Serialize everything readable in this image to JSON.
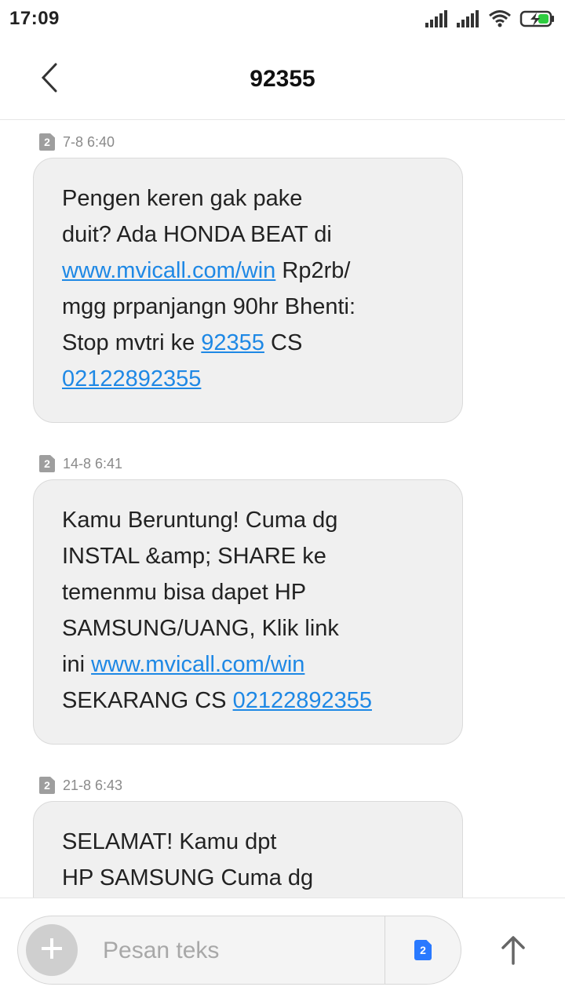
{
  "status_bar": {
    "time": "17:09",
    "icons": [
      "signal-icon",
      "signal-icon",
      "wifi-icon",
      "battery-charging-icon"
    ]
  },
  "header": {
    "title": "92355",
    "back_icon": "chevron-left-icon"
  },
  "messages": [
    {
      "sim": "2",
      "time": "7-8 6:40",
      "lines": [
        [
          {
            "t": "Pengen keren gak pake"
          }
        ],
        [
          {
            "t": "duit? Ada HONDA BEAT di"
          }
        ],
        [
          {
            "t": "www.mvicall.com/win",
            "link": true
          },
          {
            "t": " Rp2rb/"
          }
        ],
        [
          {
            "t": "mgg prpanjangn 90hr Bhenti:"
          }
        ],
        [
          {
            "t": "Stop mvtri ke "
          },
          {
            "t": "92355",
            "link": true
          },
          {
            "t": " CS"
          }
        ],
        [
          {
            "t": "02122892355",
            "link": true
          }
        ]
      ]
    },
    {
      "sim": "2",
      "time": "14-8 6:41",
      "lines": [
        [
          {
            "t": "Kamu Beruntung! Cuma dg"
          }
        ],
        [
          {
            "t": "INSTAL &amp; SHARE ke"
          }
        ],
        [
          {
            "t": "temenmu bisa dapet HP"
          }
        ],
        [
          {
            "t": "SAMSUNG/UANG, Klik link"
          }
        ],
        [
          {
            "t": "ini "
          },
          {
            "t": "www.mvicall.com/win",
            "link": true
          }
        ],
        [
          {
            "t": "SEKARANG CS "
          },
          {
            "t": "02122892355",
            "link": true
          }
        ]
      ]
    },
    {
      "sim": "2",
      "time": "21-8 6:43",
      "lines": [
        [
          {
            "t": "SELAMAT! Kamu dpt"
          }
        ],
        [
          {
            "t": "HP SAMSUNG Cuma dg"
          }
        ]
      ]
    }
  ],
  "compose": {
    "placeholder": "Pesan teks",
    "sim": "2",
    "add_icon": "plus-icon",
    "send_icon": "arrow-up-icon"
  },
  "colors": {
    "link": "#1e88e5",
    "bubble_bg": "#f0f0f0",
    "sim_badge": "#9e9e9e",
    "sim_select": "#2979ff",
    "battery_charge": "#2ecc40"
  }
}
